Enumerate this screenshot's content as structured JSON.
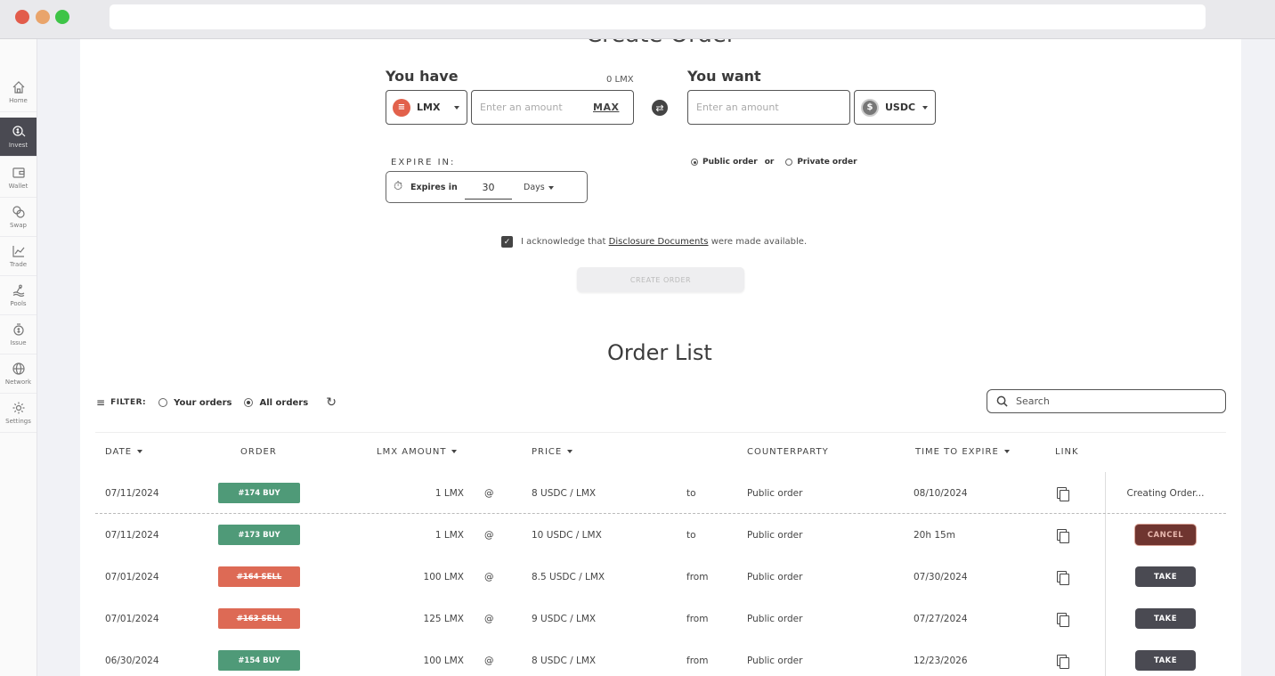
{
  "sidebar": {
    "items": [
      {
        "label": "Home",
        "icon": "home-icon"
      },
      {
        "label": "Invest",
        "icon": "invest-icon",
        "active": true
      },
      {
        "label": "Wallet",
        "icon": "wallet-icon"
      },
      {
        "label": "Swap",
        "icon": "swap-icon"
      },
      {
        "label": "Trade",
        "icon": "trade-icon"
      },
      {
        "label": "Pools",
        "icon": "pools-icon"
      },
      {
        "label": "Issue",
        "icon": "issue-icon"
      },
      {
        "label": "Network",
        "icon": "globe-icon"
      },
      {
        "label": "Settings",
        "icon": "gear-icon"
      }
    ]
  },
  "create_order": {
    "title": "Create Order",
    "you_have_label": "You have",
    "balance": "0 LMX",
    "have_token": "LMX",
    "amount_placeholder": "Enter an amount",
    "max_label": "MAX",
    "you_want_label": "You want",
    "want_placeholder": "Enter an amount",
    "want_token": "USDC",
    "public_label": "Public order",
    "or_label": "or",
    "private_label": "Private order",
    "expire_label": "EXPIRE IN:",
    "expires_in_label": "Expires in",
    "expires_value": "30",
    "expires_unit": "Days",
    "ack_prefix": "I acknowledge that",
    "ack_link": "Disclosure Documents",
    "ack_suffix": "were made available.",
    "create_button": "CREATE ORDER"
  },
  "order_list": {
    "title": "Order List",
    "filter_label": "FILTER:",
    "your_orders": "Your orders",
    "all_orders": "All orders",
    "search_placeholder": "Search",
    "headers": {
      "date": "DATE",
      "order": "ORDER",
      "amount": "LMX AMOUNT",
      "price": "PRICE",
      "counterparty": "COUNTERPARTY",
      "expire": "TIME TO EXPIRE",
      "link": "LINK"
    },
    "rows": [
      {
        "date": "07/11/2024",
        "order": "#174 BUY",
        "side": "buy",
        "amount": "1 LMX",
        "at": "@",
        "price": "8 USDC / LMX",
        "dir": "to",
        "counterparty": "Public order",
        "expire": "08/10/2024",
        "action": "Creating Order...",
        "action_type": "status"
      },
      {
        "date": "07/11/2024",
        "order": "#173 BUY",
        "side": "buy",
        "amount": "1 LMX",
        "at": "@",
        "price": "10 USDC / LMX",
        "dir": "to",
        "counterparty": "Public order",
        "expire": "20h 15m",
        "action": "CANCEL",
        "action_type": "cancel"
      },
      {
        "date": "07/01/2024",
        "order": "#164 SELL",
        "side": "sell",
        "amount": "100 LMX",
        "at": "@",
        "price": "8.5 USDC / LMX",
        "dir": "from",
        "counterparty": "Public order",
        "expire": "07/30/2024",
        "action": "TAKE",
        "action_type": "take"
      },
      {
        "date": "07/01/2024",
        "order": "#163 SELL",
        "side": "sell",
        "amount": "125 LMX",
        "at": "@",
        "price": "9 USDC / LMX",
        "dir": "from",
        "counterparty": "Public order",
        "expire": "07/27/2024",
        "action": "TAKE",
        "action_type": "take"
      },
      {
        "date": "06/30/2024",
        "order": "#154 BUY",
        "side": "buy",
        "amount": "100 LMX",
        "at": "@",
        "price": "8 USDC / LMX",
        "dir": "from",
        "counterparty": "Public order",
        "expire": "12/23/2026",
        "action": "TAKE",
        "action_type": "take"
      }
    ]
  },
  "colors": {
    "buy": "#4f9a78",
    "sell": "#dd6a55",
    "take": "#4a4a52",
    "cancel": "#6f3530"
  }
}
